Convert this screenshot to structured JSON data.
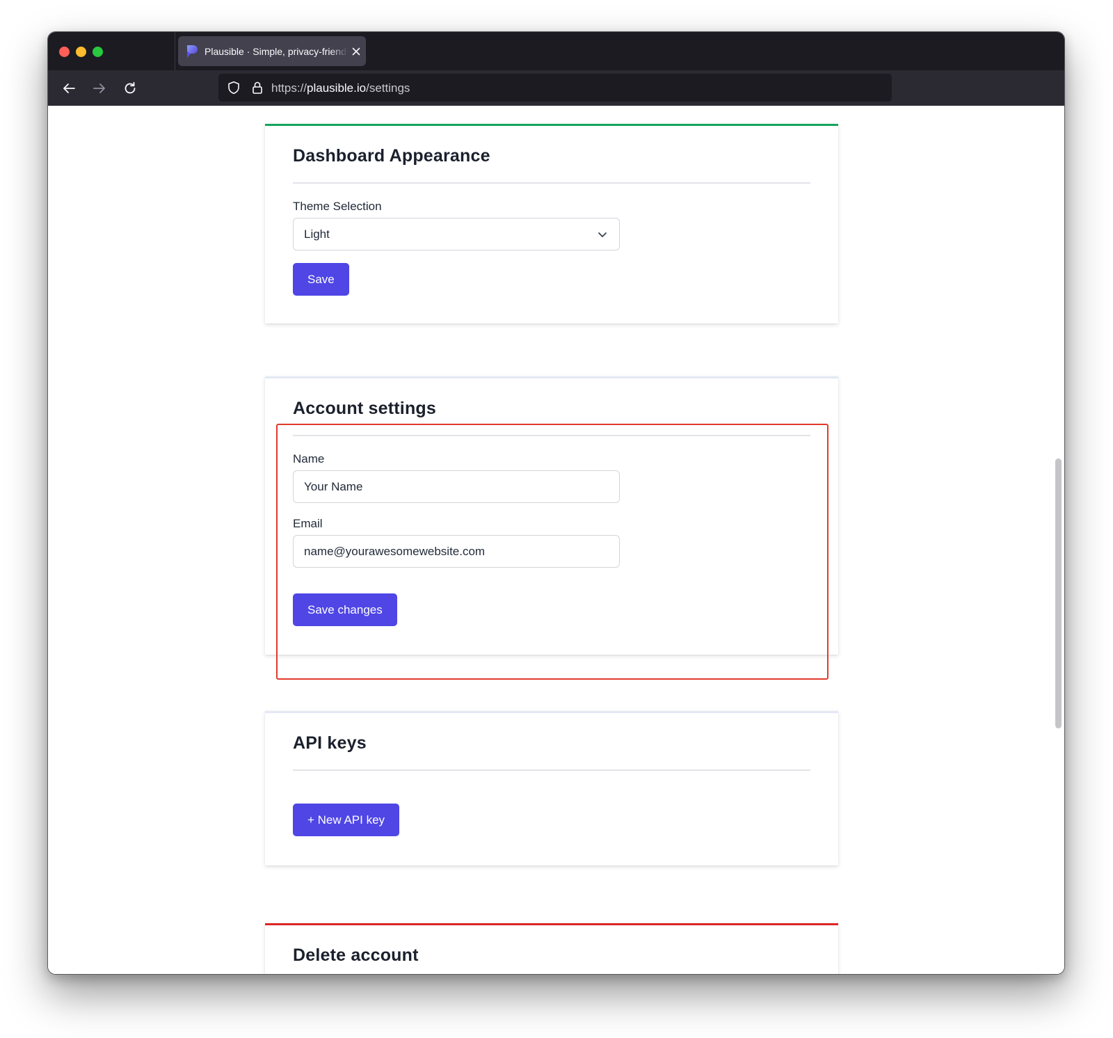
{
  "browser": {
    "tab_title": "Plausible · Simple, privacy-friendly",
    "url_scheme": "https://",
    "url_host": "plausible.io",
    "url_path": "/settings"
  },
  "colors": {
    "accent": "#4f46e5",
    "dashboard_card_border": "#16a35d",
    "danger_card_border": "#dc2626",
    "highlight_outline": "#e23a2c"
  },
  "dashboard": {
    "title": "Dashboard Appearance",
    "theme_label": "Theme Selection",
    "theme_selected": "Light",
    "save_label": "Save"
  },
  "account": {
    "title": "Account settings",
    "name_label": "Name",
    "name_value": "Your Name",
    "email_label": "Email",
    "email_value": "name@yourawesomewebsite.com",
    "save_label": "Save changes"
  },
  "api_keys": {
    "title": "API keys",
    "new_key_label": "+ New API key"
  },
  "delete_account": {
    "title": "Delete account"
  }
}
